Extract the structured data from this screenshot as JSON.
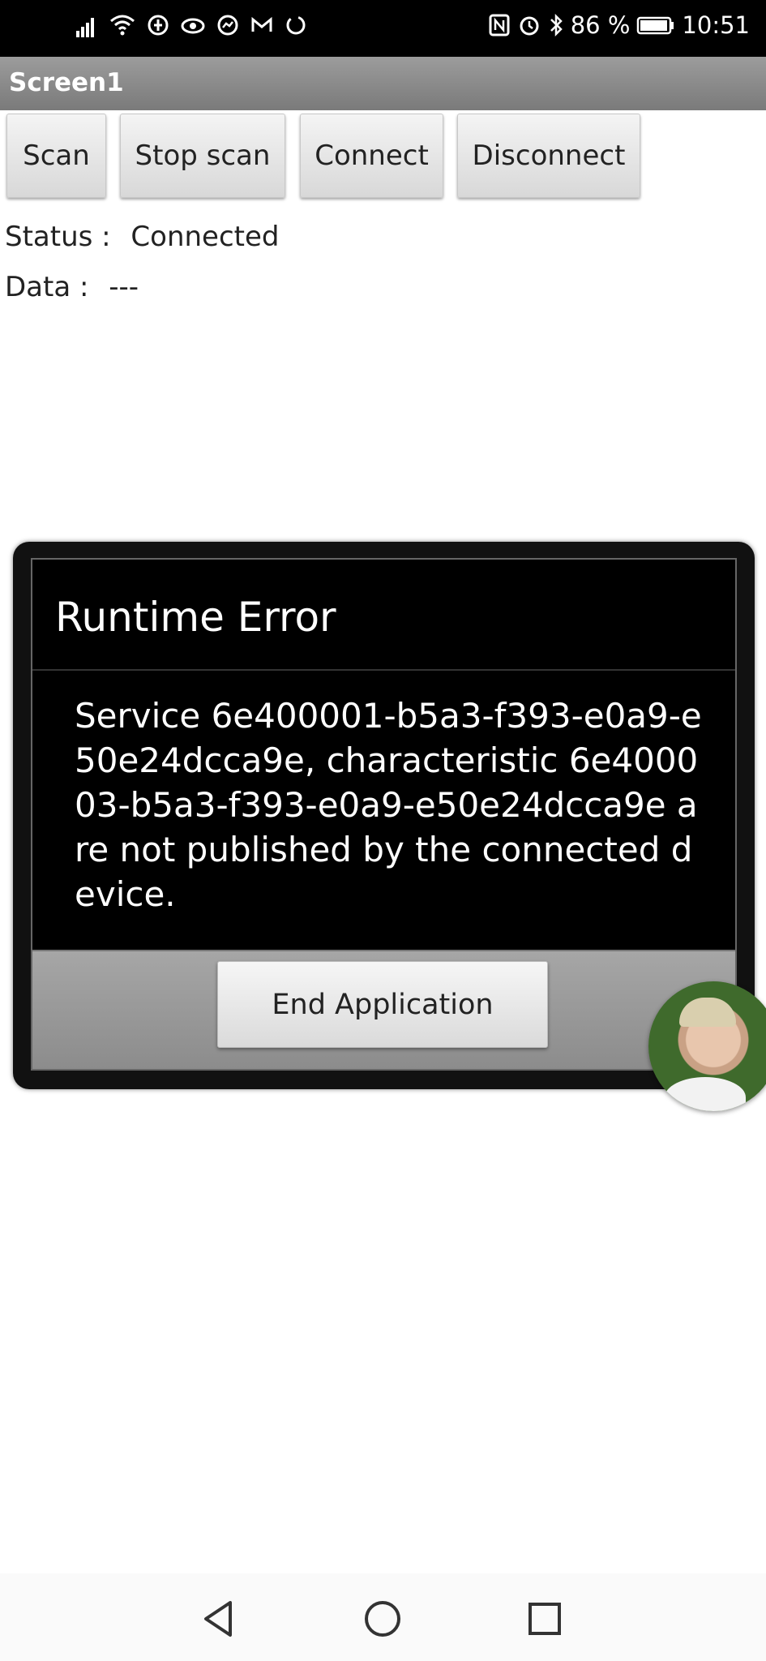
{
  "status_bar": {
    "battery_percent": "86 %",
    "time": "10:51",
    "icons": [
      "signal-icon",
      "wifi-icon",
      "data-saver-icon",
      "eye-icon",
      "messenger-icon",
      "gmail-icon",
      "sync-icon",
      "nfc-icon",
      "alarm-icon",
      "bluetooth-icon",
      "battery-icon"
    ]
  },
  "app": {
    "title": "Screen1"
  },
  "buttons": {
    "scan": "Scan",
    "stop_scan": "Stop scan",
    "connect": "Connect",
    "disconnect": "Disconnect"
  },
  "status": {
    "label": "Status :",
    "value": "Connected"
  },
  "data": {
    "label": "Data :",
    "value": "---"
  },
  "dialog": {
    "title": "Runtime Error",
    "message": "Service 6e400001-b5a3-f393-e0a9-e50e24dcca9e, characteristic 6e400003-b5a3-f393-e0a9-e50e24dcca9e are not published by the connected device.",
    "button": "End Application"
  },
  "nav": {
    "icons": [
      "back-icon",
      "home-icon",
      "recents-icon"
    ]
  }
}
